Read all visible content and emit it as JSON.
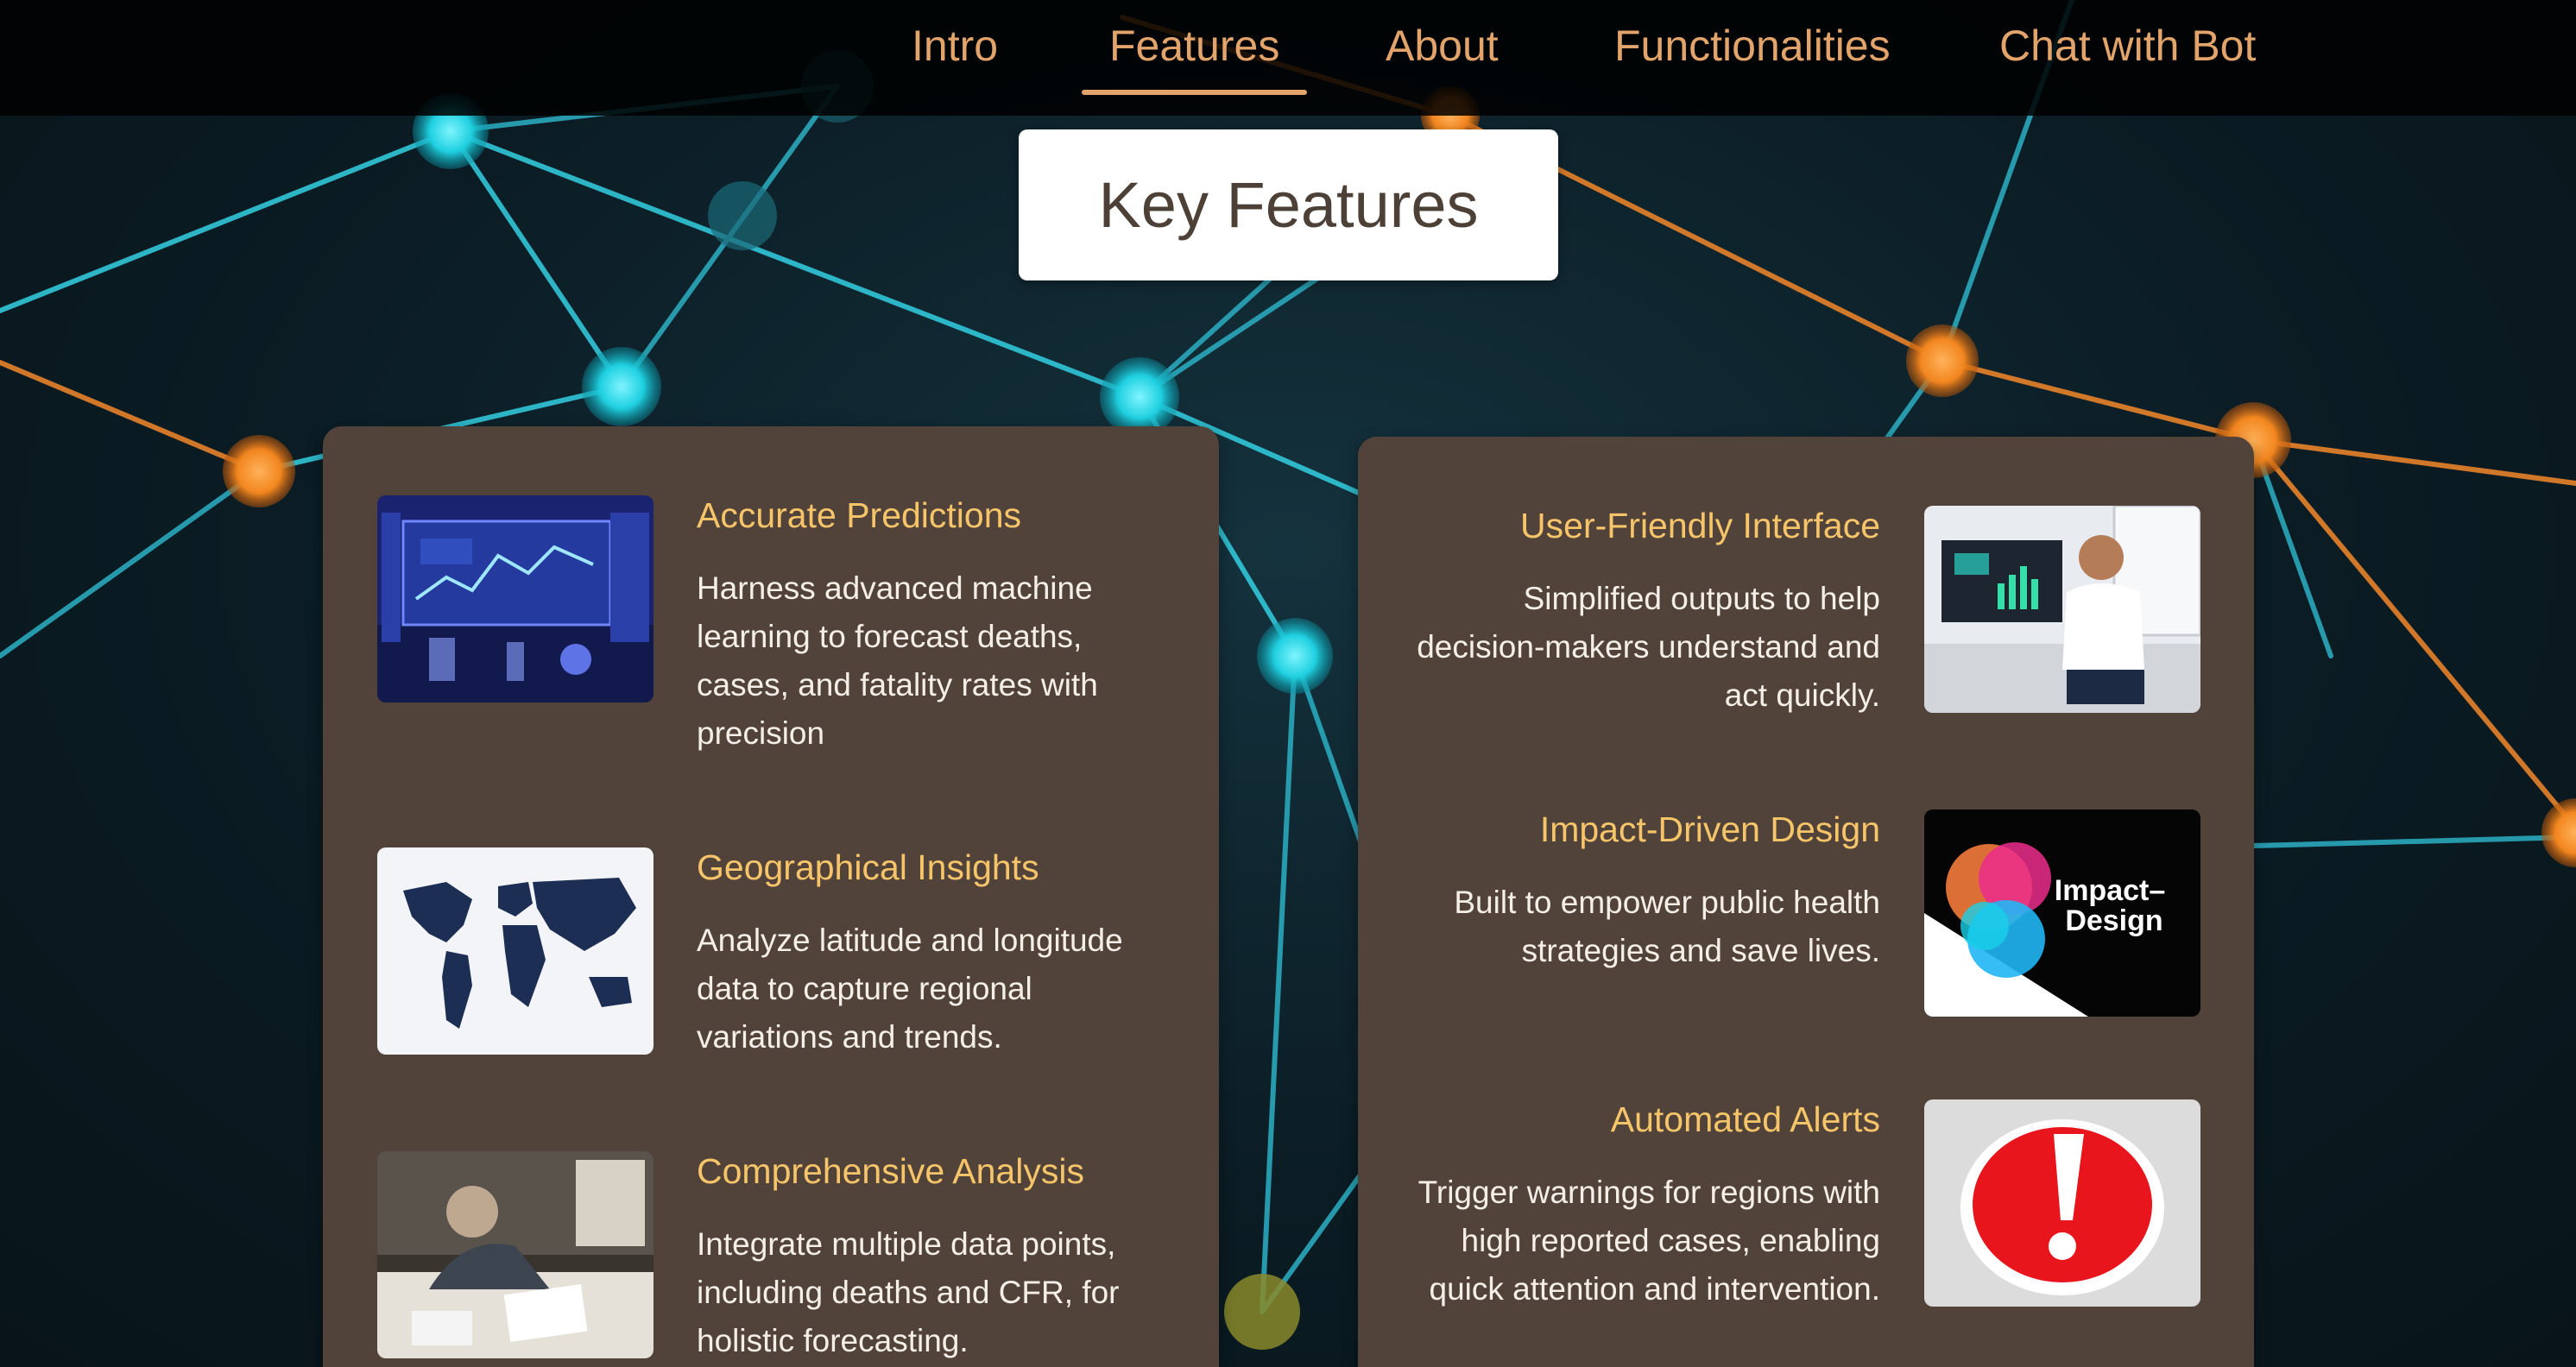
{
  "nav": {
    "items": [
      {
        "label": "Intro",
        "active": false
      },
      {
        "label": "Features",
        "active": true
      },
      {
        "label": "About",
        "active": false
      },
      {
        "label": "Functionalities",
        "active": false
      },
      {
        "label": "Chat with Bot",
        "active": false
      }
    ]
  },
  "section": {
    "title": "Key Features"
  },
  "features_left": [
    {
      "title": "Accurate Predictions",
      "description": "Harness advanced machine learning to forecast deaths, cases, and fatality rates with precision",
      "image": "lab-dashboard-image"
    },
    {
      "title": "Geographical Insights",
      "description": "Analyze latitude and longitude data to capture regional variations and trends.",
      "image": "world-map-image"
    },
    {
      "title": "Comprehensive Analysis",
      "description": "Integrate multiple data points, including deaths and CFR, for holistic forecasting.",
      "image": "analyst-desk-image"
    }
  ],
  "features_right": [
    {
      "title": "User-Friendly Interface",
      "description": "Simplified outputs to help decision-makers understand and act quickly.",
      "image": "user-at-computer-image"
    },
    {
      "title": "Impact-Driven Design",
      "description": "Built to empower public health strategies and save lives.",
      "image": "impact-design-image",
      "image_text_line1": "Impact–",
      "image_text_line2": "Design"
    },
    {
      "title": "Automated Alerts",
      "description": "Trigger warnings for regions with high reported cases, enabling quick attention and intervention.",
      "image": "alert-exclamation-image"
    }
  ],
  "colors": {
    "accent": "#e2a46a",
    "feature_title": "#f6c56a",
    "card_bg": "#52433a",
    "node_cyan": "#27d6e6",
    "node_orange": "#f28a22"
  }
}
